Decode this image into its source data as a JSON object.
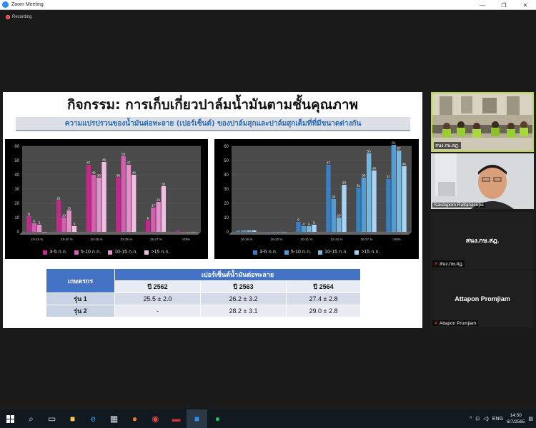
{
  "window": {
    "title": "Zoom Meeting",
    "controls": [
      "—",
      "❐",
      "✕"
    ]
  },
  "recording": {
    "label": "Recording"
  },
  "slide": {
    "title": "กิจกรรม: การเก็บเกี่ยวปาล์มน้ำมันตามชั้นคุณภาพ",
    "subtitle": "ความแปรปรวนของน้ำมันต่อทะลาย (เปอร์เซ็นต์) ของปาล์มสุกและปาล์มสุกเต็มที่ที่มีขนาดต่างกัน",
    "table": {
      "row_header": "เกษตรกร",
      "group_header": "เปอร์เซ็นต์น้ำมันต่อทะลาย",
      "years": [
        "ปี 2562",
        "ปี 2563",
        "ปี 2564"
      ],
      "rows": [
        {
          "label": "รุ่น 1",
          "values": [
            "25.5 ± 2.0",
            "26.2 ± 3.2",
            "27.4 ± 2.8"
          ]
        },
        {
          "label": "รุ่น 2",
          "values": [
            "-",
            "28.2 ± 3.1",
            "29.0 ± 2.8"
          ]
        }
      ]
    }
  },
  "chart_data": [
    {
      "type": "bar",
      "categories": [
        "10-15 %",
        "15-20 %",
        "20-25 %",
        "22-25 %",
        "25-27 %",
        ">28%"
      ],
      "ylim": [
        0,
        60
      ],
      "yticks": [
        "0",
        "10",
        "20",
        "30",
        "40",
        "50",
        "60"
      ],
      "colors": [
        "#c2298a",
        "#d85cb0",
        "#e58fcc",
        "#f2bde2"
      ],
      "series": [
        {
          "name": "3-5 ก.ก.",
          "values": [
            11,
            22,
            47,
            38,
            8,
            1
          ]
        },
        {
          "name": "5-10 ก.ก.",
          "values": [
            6,
            10,
            40,
            53,
            17,
            0
          ]
        },
        {
          "name": "10-15 ก.ก.",
          "values": [
            5,
            15,
            38,
            47,
            21,
            0
          ]
        },
        {
          "name": ">15 ก.ก.",
          "values": [
            0,
            4,
            49,
            40,
            32,
            0
          ]
        }
      ],
      "labels": [
        [
          "11",
          "22",
          "47",
          "38",
          "8",
          ""
        ],
        [
          "6",
          "10",
          "40",
          "53",
          "17",
          ""
        ],
        [
          "5",
          "15",
          "38",
          "47",
          "21",
          ""
        ],
        [
          "",
          "4",
          "49",
          "40",
          "32",
          ""
        ]
      ]
    },
    {
      "type": "bar",
      "categories": [
        "10-15 %",
        "15-20 %",
        "20-21 %",
        "22-24 %",
        "25-27 %",
        ">28%"
      ],
      "ylim": [
        0,
        60
      ],
      "yticks": [
        "0",
        "10",
        "20",
        "30",
        "40",
        "50",
        "60"
      ],
      "colors": [
        "#3a7fc0",
        "#4f9dd6",
        "#72b9e6",
        "#a8d3f2"
      ],
      "series": [
        {
          "name": "3-6 ก.ก.",
          "values": [
            1,
            0,
            7,
            47,
            31,
            37
          ]
        },
        {
          "name": "5-10 ก.ก.",
          "values": [
            1,
            0,
            4,
            23,
            38,
            61
          ]
        },
        {
          "name": "10-15 ก.ก.",
          "values": [
            1,
            0,
            4,
            10,
            55,
            57
          ]
        },
        {
          "name": ">15 ก.ก.",
          "values": [
            1,
            0,
            5,
            33,
            43,
            46
          ]
        }
      ],
      "labels": [
        [
          "",
          "",
          "6",
          "47",
          "31",
          "37"
        ],
        [
          "",
          "",
          "4",
          "23",
          "38",
          "61"
        ],
        [
          "",
          "",
          "4",
          "10",
          "55",
          "57"
        ],
        [
          "",
          "",
          "5",
          "33",
          "43",
          "46"
        ]
      ]
    }
  ],
  "participants": [
    {
      "name": "สนง.กษ.สฎ.",
      "type": "video-room"
    },
    {
      "name": "Sakdapom Rattanasupa",
      "type": "video-person"
    },
    {
      "name": "สนง.กษ.สฎ.",
      "center": "สนง.กษ.สฎ.",
      "type": "name-only"
    },
    {
      "name": "Attapon Promjiam",
      "center": "Attapon Promjiam",
      "type": "name-only"
    }
  ],
  "taskbar": {
    "language": "ENG",
    "time": "14:50",
    "date": "6/7/2565"
  }
}
